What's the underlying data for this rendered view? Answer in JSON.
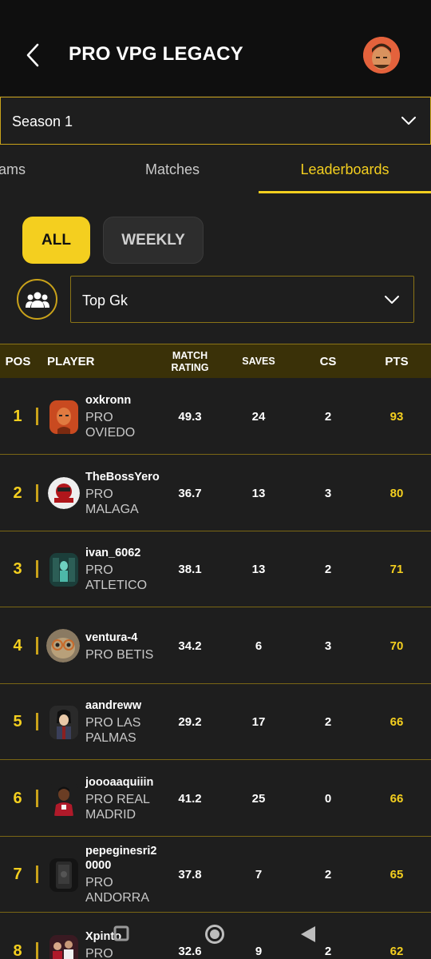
{
  "header": {
    "title": "PRO VPG LEGACY"
  },
  "season": {
    "value": "Season 1"
  },
  "tabs": {
    "teams": "ams",
    "matches": "Matches",
    "leaderboards": "Leaderboards"
  },
  "filters": {
    "all": "ALL",
    "weekly": "WEEKLY",
    "stat": "Top Gk"
  },
  "table": {
    "headers": {
      "pos": "POS",
      "player": "PLAYER",
      "rating_1": "MATCH",
      "rating_2": "RATING",
      "saves": "SAVES",
      "cs": "CS",
      "pts": "PTS"
    },
    "rows": [
      {
        "pos": "1",
        "name": "oxkronn",
        "team": "PRO OVIEDO",
        "rating": "49.3",
        "saves": "24",
        "cs": "2",
        "pts": "93"
      },
      {
        "pos": "2",
        "name": "TheBossYero",
        "team": "PRO MALAGA",
        "rating": "36.7",
        "saves": "13",
        "cs": "3",
        "pts": "80"
      },
      {
        "pos": "3",
        "name": "ivan_6062",
        "team": "PRO ATLETICO",
        "rating": "38.1",
        "saves": "13",
        "cs": "2",
        "pts": "71"
      },
      {
        "pos": "4",
        "name": "ventura-4",
        "team": "PRO BETIS",
        "rating": "34.2",
        "saves": "6",
        "cs": "3",
        "pts": "70"
      },
      {
        "pos": "5",
        "name": "aandreww",
        "team": "PRO LAS PALMAS",
        "rating": "29.2",
        "saves": "17",
        "cs": "2",
        "pts": "66"
      },
      {
        "pos": "6",
        "name": "joooaaquiiin",
        "team": "PRO REAL MADRID",
        "rating": "41.2",
        "saves": "25",
        "cs": "0",
        "pts": "66"
      },
      {
        "pos": "7",
        "name": "pepeginesri20000",
        "team": "PRO ANDORRA",
        "rating": "37.8",
        "saves": "7",
        "cs": "2",
        "pts": "65"
      },
      {
        "pos": "8",
        "name": "Xpinto",
        "team": "PRO",
        "rating": "32.6",
        "saves": "9",
        "cs": "2",
        "pts": "62"
      }
    ]
  },
  "colors": {
    "accent": "#f4cf1f",
    "background": "#1e1e1e",
    "header_bg": "#0f0f0f",
    "table_header_bg": "#3a3108"
  }
}
